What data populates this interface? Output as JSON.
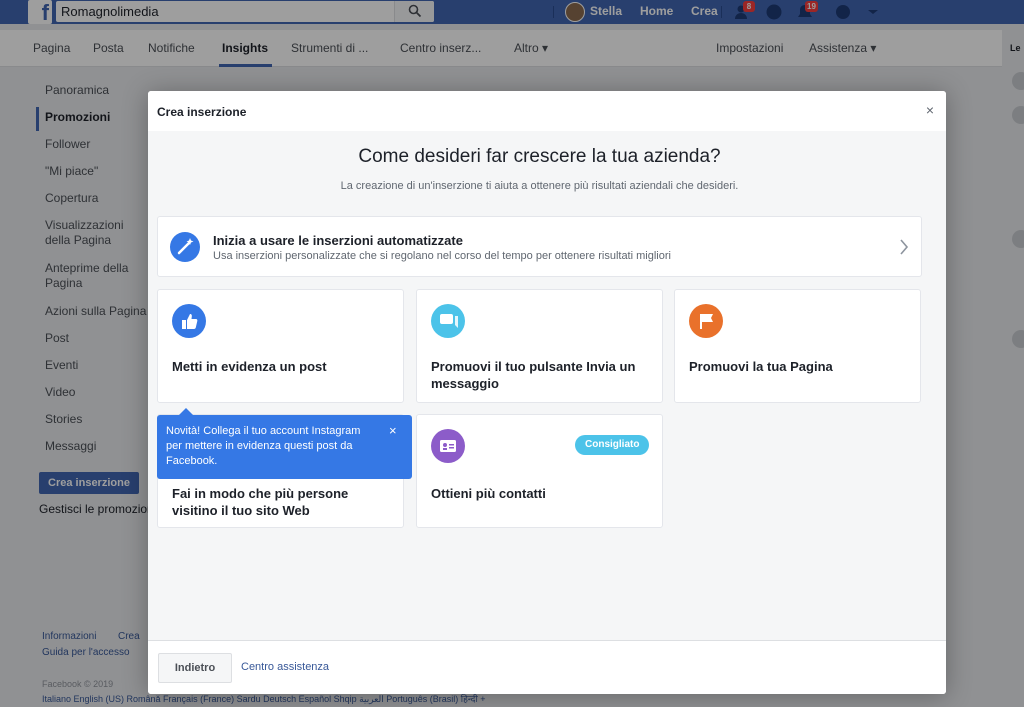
{
  "topbar": {
    "search_value": "Romagnolimedia",
    "user_name": "Stella",
    "home": "Home",
    "create": "Crea",
    "friend_requests_count": "8",
    "notifications_count": "19"
  },
  "page_tabs": [
    {
      "label": "Pagina"
    },
    {
      "label": "Posta"
    },
    {
      "label": "Notifiche"
    },
    {
      "label": "Insights"
    },
    {
      "label": "Strumenti di ..."
    },
    {
      "label": "Centro inserz..."
    },
    {
      "label": "Altro ▾"
    },
    {
      "label": "Impostazioni"
    },
    {
      "label": "Assistenza ▾"
    }
  ],
  "right_column": {
    "label": "Le"
  },
  "sidebar": {
    "items": [
      {
        "label": "Panoramica"
      },
      {
        "label": "Promozioni"
      },
      {
        "label": "Follower"
      },
      {
        "label": "\"Mi piace\""
      },
      {
        "label": "Copertura"
      },
      {
        "label": "Visualizzazioni della Pagina"
      },
      {
        "label": "Anteprime della Pagina"
      },
      {
        "label": "Azioni sulla Pagina"
      },
      {
        "label": "Post"
      },
      {
        "label": "Eventi"
      },
      {
        "label": "Video"
      },
      {
        "label": "Stories"
      },
      {
        "label": "Messaggi"
      }
    ],
    "create_button": "Crea inserzione",
    "manage_link": "Gestisci le promozioni"
  },
  "footer": {
    "info": "Informazioni",
    "create": "Crea",
    "guide": "Guida per l'accesso",
    "copyright": "Facebook © 2019",
    "languages": "Italiano   English (US)   Română   Français (France)   Sardu   Deutsch   Español   Shqip   العربية   Português (Brasil)   हिन्दी   +"
  },
  "modal": {
    "title": "Crea inserzione",
    "close": "×",
    "heading": "Come desideri far crescere la tua azienda?",
    "subheading": "La creazione di un'inserzione ti aiuta a ottenere più risultati aziendali che desideri.",
    "auto_card": {
      "title": "Inizia a usare le inserzioni automatizzate",
      "description": "Usa inserzioni personalizzate che si regolano nel corso del tempo per ottenere risultati migliori"
    },
    "objectives": [
      {
        "label": "Metti in evidenza un post",
        "icon": "thumbs-up-icon",
        "color": "#3578e5"
      },
      {
        "label": "Promuovi il tuo pulsante Invia un messaggio",
        "icon": "chat-bubble-icon",
        "color": "#4cc3e9"
      },
      {
        "label": "Promuovi la tua Pagina",
        "icon": "flag-icon",
        "color": "#e9712b"
      },
      {
        "label": "Fai in modo che più persone visitino il tuo sito Web",
        "icon": "cursor-icon",
        "color": "#3578e5"
      },
      {
        "label": "Ottieni più contatti",
        "icon": "contact-card-icon",
        "color": "#8c5cc9",
        "badge": "Consigliato"
      }
    ],
    "tooltip": {
      "text": "Novità! Collega il tuo account Instagram per mettere in evidenza questi post da Facebook.",
      "close": "×"
    },
    "footer": {
      "back": "Indietro",
      "help": "Centro assistenza"
    }
  }
}
